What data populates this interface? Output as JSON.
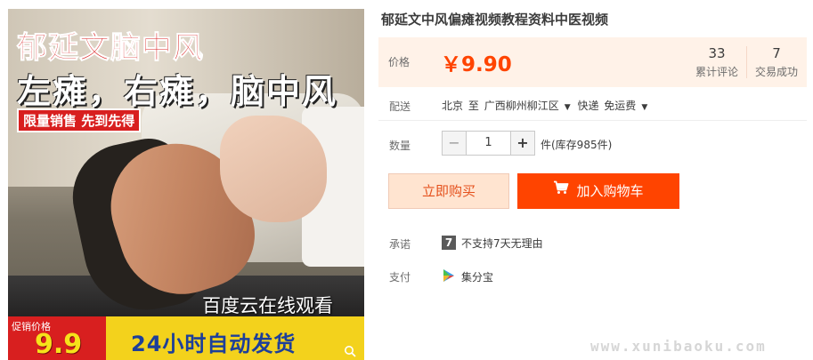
{
  "image": {
    "title": "郁延文脑中风",
    "subtitle": "左瘫，右瘫，脑中风",
    "tag": "限量销售 先到先得",
    "overlay_text": "百度云在线观看",
    "promo_label": "促销价格",
    "promo_price": "9.9",
    "shipping_banner": "24小时自动发货",
    "zoom_icon": "magnifier-icon"
  },
  "product": {
    "title": "郁延文中风偏瘫视频教程资料中医视频"
  },
  "price": {
    "label": "价格",
    "value": "￥9.90",
    "reviews_count": "33",
    "reviews_label": "累计评论",
    "sales_count": "7",
    "sales_label": "交易成功"
  },
  "delivery": {
    "label": "配送",
    "from": "北京",
    "to_word": "至",
    "destination": "广西柳州柳江区",
    "method": "快递",
    "fee": "免运费"
  },
  "quantity": {
    "label": "数量",
    "minus": "−",
    "value": "1",
    "plus": "+",
    "stock": "件(库存985件)"
  },
  "actions": {
    "buy_now": "立即购买",
    "add_to_cart": "加入购物车"
  },
  "promise": {
    "label": "承诺",
    "icon_text": "7",
    "text": "不支持7天无理由"
  },
  "payment": {
    "label": "支付",
    "text": "集分宝"
  },
  "watermark": "www.xunibaoku.com",
  "colors": {
    "accent": "#ff4400",
    "price": "#ff4400",
    "price_panel": "#fff2e8"
  }
}
